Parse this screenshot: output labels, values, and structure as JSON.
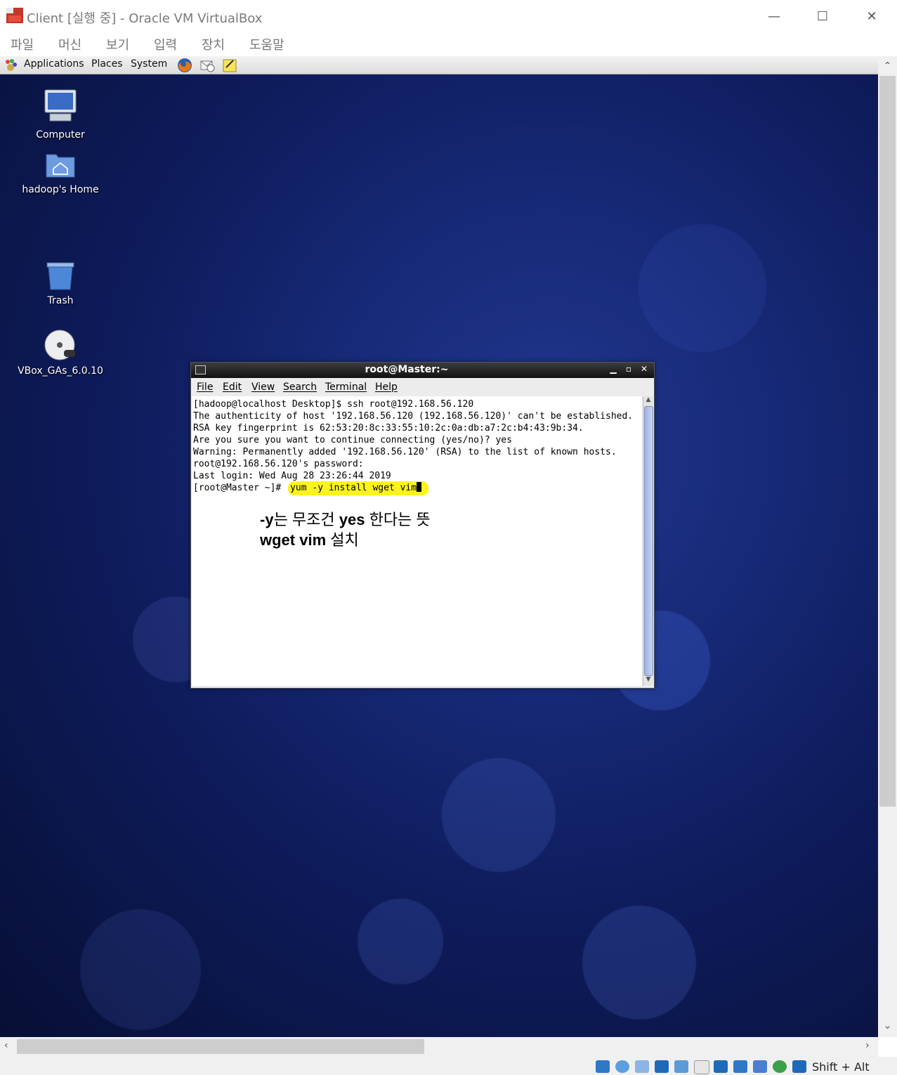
{
  "window": {
    "title": "Client [실행 중] - Oracle VM VirtualBox",
    "min_glyph": "—",
    "max_glyph": "☐",
    "close_glyph": "✕"
  },
  "vbox_menu": [
    "파일",
    "머신",
    "보기",
    "입력",
    "장치",
    "도움말"
  ],
  "guest_panel": {
    "menus": [
      "Applications",
      "Places",
      "System"
    ],
    "launchers": [
      "firefox-icon",
      "email-icon",
      "notes-icon"
    ]
  },
  "desktop_icons": [
    {
      "label": "Computer",
      "icon": "computer-icon"
    },
    {
      "label": "hadoop's Home",
      "icon": "home-folder-icon"
    },
    {
      "label": "Trash",
      "icon": "trash-icon"
    },
    {
      "label": "VBox_GAs_6.0.10",
      "icon": "cd-icon"
    }
  ],
  "terminal": {
    "title": "root@Master:~",
    "menus": [
      "File",
      "Edit",
      "View",
      "Search",
      "Terminal",
      "Help"
    ],
    "lines": [
      "[hadoop@localhost Desktop]$ ssh root@192.168.56.120",
      "The authenticity of host '192.168.56.120 (192.168.56.120)' can't be established.",
      "RSA key fingerprint is 62:53:20:8c:33:55:10:2c:0a:db:a7:2c:b4:43:9b:34.",
      "Are you sure you want to continue connecting (yes/no)? yes",
      "Warning: Permanently added '192.168.56.120' (RSA) to the list of known hosts.",
      "root@192.168.56.120's password: ",
      "Last login: Wed Aug 28 23:26:44 2019"
    ],
    "prompt": "[root@Master ~]# ",
    "command": "yum -y install wget vim"
  },
  "annotation": {
    "line1_bold_a": "-y",
    "line1_normal_a": "는 무조건 ",
    "line1_bold_b": "yes",
    "line1_normal_b": " 한다는 뜻",
    "line2_bold": "wget vim",
    "line2_normal": " 설치"
  },
  "statusbar": {
    "hostkey": "Shift + Alt",
    "icons": [
      "hard-disk-icon",
      "optical-drive-icon",
      "audio-icon",
      "network-icon",
      "usb-icon",
      "shared-folder-icon",
      "display-icon",
      "recording-icon",
      "virtualbox-icon",
      "guest-additions-icon",
      "download-arrow-icon"
    ]
  },
  "colors": {
    "highlight": "#fcf41a",
    "desktop_dark": "#070f35",
    "desktop_mid": "#172a78"
  }
}
